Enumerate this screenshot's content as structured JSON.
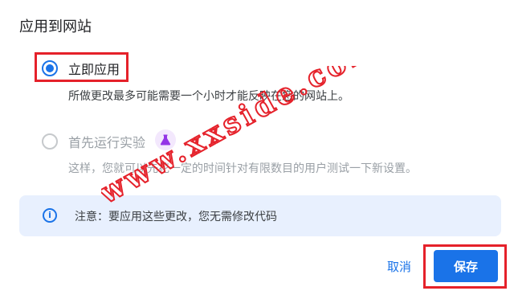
{
  "dialog": {
    "title": "应用到网站"
  },
  "options": [
    {
      "label": "立即应用",
      "description": "所做更改最多可能需要一个小时才能反映在您的网站上。",
      "selected": true
    },
    {
      "label": "首先运行实验",
      "description": "这样，您就可以先花一定的时间针对有限数目的用户测试一下新设置。",
      "selected": false,
      "icon": "beaker-icon"
    }
  ],
  "notice": {
    "icon": "info-icon",
    "text": "注意：要应用这些更改，您无需修改代码"
  },
  "buttons": {
    "cancel": "取消",
    "save": "保存"
  },
  "watermark": "www.xxside.com",
  "colors": {
    "accent": "#1a73e8",
    "highlight_box": "#e5212a",
    "notice_bg": "#e8f0fe",
    "watermark": "#e5212a"
  }
}
